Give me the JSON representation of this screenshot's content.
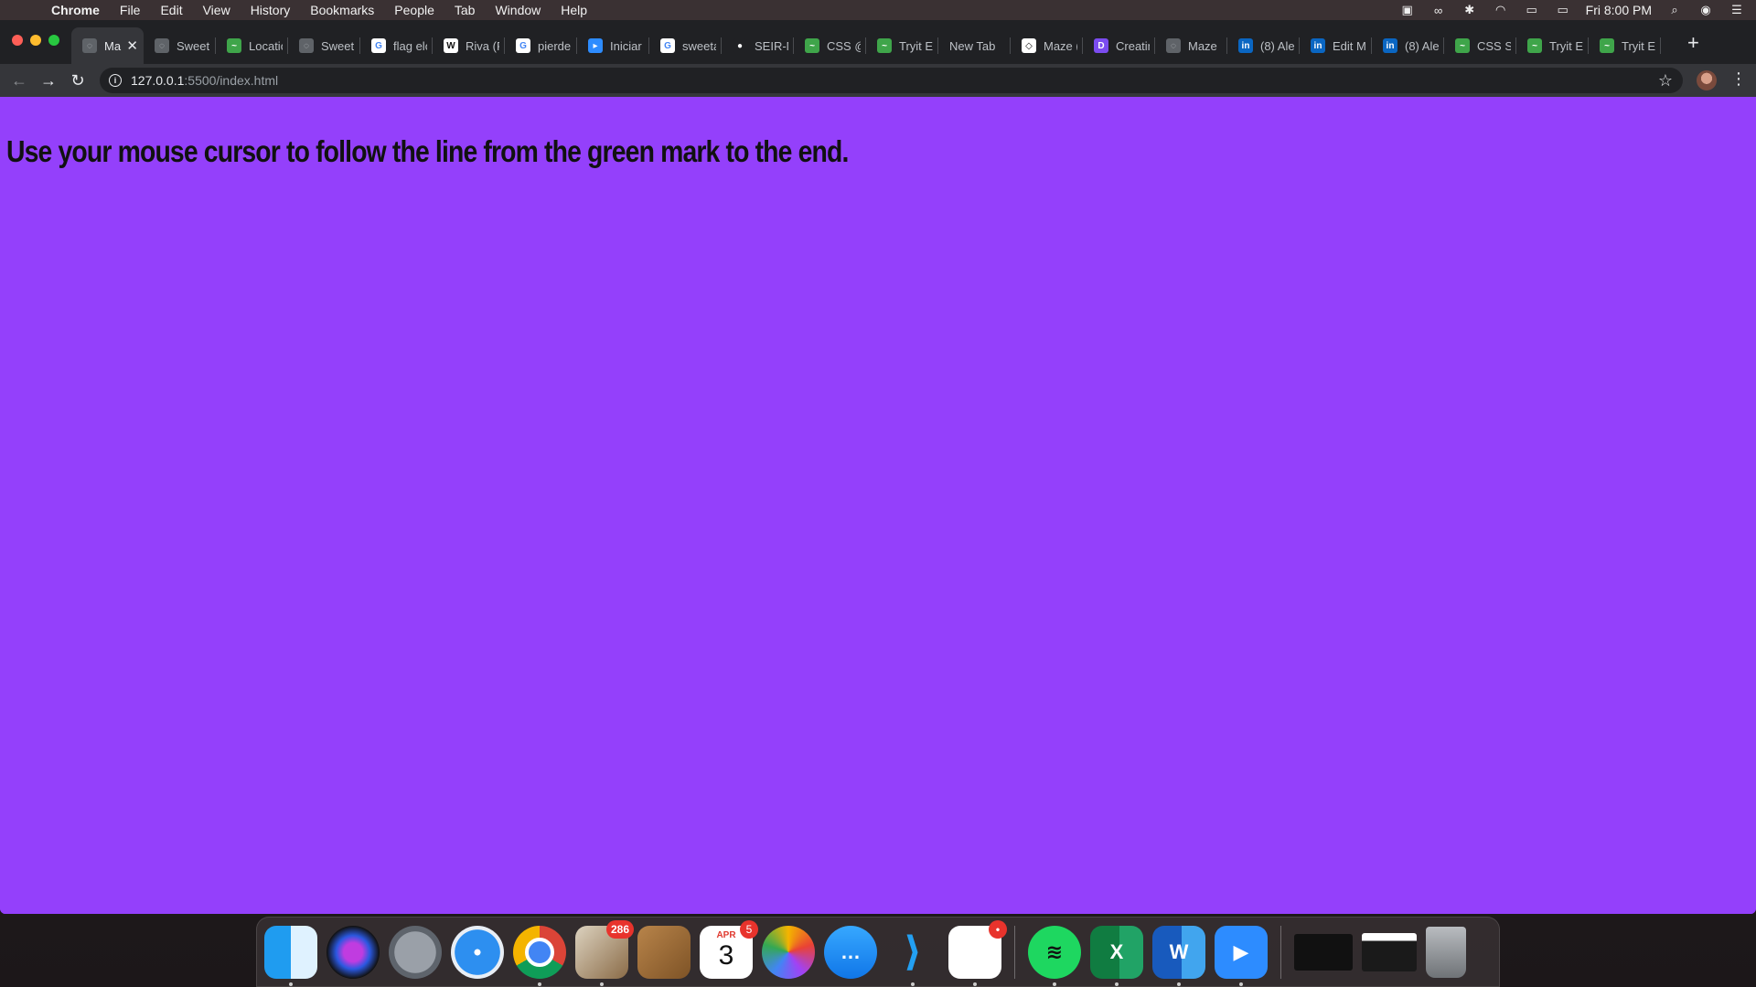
{
  "menubar": {
    "app": "Chrome",
    "items": [
      "File",
      "Edit",
      "View",
      "History",
      "Bookmarks",
      "People",
      "Tab",
      "Window",
      "Help"
    ],
    "clock": "Fri 8:00 PM",
    "status_icons": [
      "zoom-icon",
      "glasses-icon",
      "bluetooth-icon",
      "wifi-icon",
      "airplay-icon",
      "battery-icon",
      "search-icon",
      "siri-icon",
      "control-center-icon"
    ]
  },
  "browser": {
    "tabs": [
      {
        "label": "Ma",
        "icon": "globe-icon",
        "color": "#5f6368"
      },
      {
        "label": "Sweet",
        "icon": "globe-icon",
        "color": "#5f6368"
      },
      {
        "label": "Locatio",
        "icon": "chart-icon",
        "color": "#3fa54a"
      },
      {
        "label": "Sweet",
        "icon": "globe-icon",
        "color": "#5f6368"
      },
      {
        "label": "flag elo",
        "icon": "google-icon",
        "color": "#ffffff"
      },
      {
        "label": "Riva (R",
        "icon": "wikipedia-icon",
        "color": "#ffffff"
      },
      {
        "label": "pierde",
        "icon": "google-icon",
        "color": "#ffffff"
      },
      {
        "label": "Iniciar",
        "icon": "zoom-icon",
        "color": "#2d8cff"
      },
      {
        "label": "sweeta",
        "icon": "google-icon",
        "color": "#ffffff"
      },
      {
        "label": "SEIR-M",
        "icon": "github-icon",
        "color": "#202124"
      },
      {
        "label": "CSS @",
        "icon": "chart-icon",
        "color": "#3fa54a"
      },
      {
        "label": "Tryit E",
        "icon": "chart-icon",
        "color": "#3fa54a"
      },
      {
        "label": "New Tab",
        "icon": "",
        "color": ""
      },
      {
        "label": "Maze (",
        "icon": "codepen-icon",
        "color": "#ffffff"
      },
      {
        "label": "Creatin",
        "icon": "dev-icon",
        "color": "#7b4cf0"
      },
      {
        "label": "Maze",
        "icon": "globe-icon",
        "color": "#5f6368"
      },
      {
        "label": "(8) Ale",
        "icon": "linkedin-icon",
        "color": "#0a66c2"
      },
      {
        "label": "Edit M",
        "icon": "linkedin-icon",
        "color": "#0a66c2"
      },
      {
        "label": "(8) Ale",
        "icon": "linkedin-icon",
        "color": "#0a66c2"
      },
      {
        "label": "CSS St",
        "icon": "chart-icon",
        "color": "#3fa54a"
      },
      {
        "label": "Tryit E",
        "icon": "chart-icon",
        "color": "#3fa54a"
      },
      {
        "label": "Tryit E",
        "icon": "chart-icon",
        "color": "#3fa54a"
      }
    ],
    "url_host": "127.0.0.1",
    "url_rest": ":5500/index.html",
    "accent": "#9440fb"
  },
  "page": {
    "instruction": "Use your mouse cursor to follow the line from the green mark to the end.",
    "background": "#9440fb"
  },
  "dock": {
    "items": [
      {
        "name": "finder",
        "badge": ""
      },
      {
        "name": "siri",
        "badge": ""
      },
      {
        "name": "launchpad",
        "badge": ""
      },
      {
        "name": "safari",
        "badge": ""
      },
      {
        "name": "chrome",
        "badge": ""
      },
      {
        "name": "mail",
        "badge": "286"
      },
      {
        "name": "contacts",
        "badge": ""
      },
      {
        "name": "calendar",
        "badge": "5",
        "month": "APR",
        "day": "3"
      },
      {
        "name": "photos",
        "badge": ""
      },
      {
        "name": "messages",
        "badge": ""
      },
      {
        "name": "vscode",
        "badge": ""
      },
      {
        "name": "slack",
        "badge": "•"
      },
      {
        "name": "spotify",
        "badge": ""
      },
      {
        "name": "excel",
        "badge": "",
        "letter": "X"
      },
      {
        "name": "word",
        "badge": "",
        "letter": "W"
      },
      {
        "name": "zoom",
        "badge": ""
      }
    ]
  }
}
